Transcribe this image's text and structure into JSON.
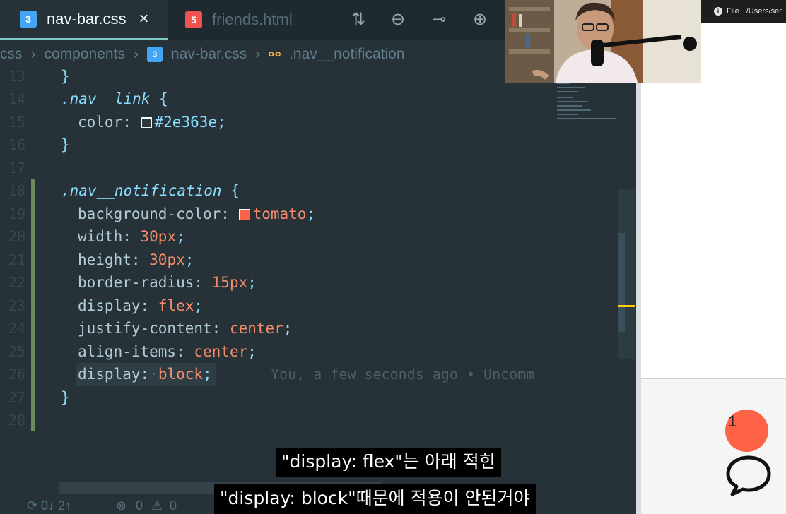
{
  "editor": {
    "tabs": [
      {
        "label": "nav-bar.css",
        "icon": "css3-icon",
        "active": true
      },
      {
        "label": "friends.html",
        "icon": "html5-icon",
        "active": false
      }
    ],
    "toolbar_icons": [
      "source-control-icon",
      "go-back-icon",
      "timeline-icon",
      "go-forward-icon"
    ],
    "breadcrumb": [
      "css",
      "components",
      "nav-bar.css",
      ".nav__notification"
    ],
    "lines": [
      {
        "n": "13",
        "text": "}"
      },
      {
        "n": "14",
        "text": ".nav__link {"
      },
      {
        "n": "15",
        "text": "color: #2e363e;"
      },
      {
        "n": "16",
        "text": "}"
      },
      {
        "n": "17",
        "text": ""
      },
      {
        "n": "18",
        "text": ".nav__notification {"
      },
      {
        "n": "19",
        "text": "background-color: tomato;"
      },
      {
        "n": "20",
        "text": "width: 30px;"
      },
      {
        "n": "21",
        "text": "height: 30px;"
      },
      {
        "n": "22",
        "text": "border-radius: 15px;"
      },
      {
        "n": "23",
        "text": "display: flex;"
      },
      {
        "n": "24",
        "text": "justify-content: center;"
      },
      {
        "n": "25",
        "text": "align-items: center;"
      },
      {
        "n": "26",
        "text": "display: block;"
      },
      {
        "n": "27",
        "text": "}"
      },
      {
        "n": "28",
        "text": ""
      }
    ],
    "code": {
      "l13": "}",
      "l14_sel": ".nav__link",
      "l14_brace": " {",
      "l15_prop": "color: ",
      "l15_val": "#2e363e",
      "l15_end": ";",
      "l16": "}",
      "l18_sel": ".nav__notification",
      "l18_brace": " {",
      "l19_prop": "background-color: ",
      "l19_val": "tomato",
      "l19_end": ";",
      "l20_prop": "width: ",
      "l20_val": "30px",
      "l20_end": ";",
      "l21_prop": "height: ",
      "l21_val": "30px",
      "l21_end": ";",
      "l22_prop": "border-radius: ",
      "l22_val": "15px",
      "l22_end": ";",
      "l23_prop": "display: ",
      "l23_val": "flex",
      "l23_end": ";",
      "l24_prop": "justify-content: ",
      "l24_val": "center",
      "l24_end": ";",
      "l25_prop": "align-items: ",
      "l25_val": "center",
      "l25_end": ";",
      "l26_prop": "display:",
      "l26_dot": "·",
      "l26_val": "block",
      "l26_end": ";",
      "l27": "}"
    },
    "blame": "You, a few seconds ago • Uncomm",
    "status": {
      "sync": "0↓ 2↑",
      "errors": "0",
      "warnings": "0"
    },
    "colors": {
      "background": "#263238",
      "accent": "#80cbc4",
      "selector": "#89ddff",
      "value": "#f78c6c"
    }
  },
  "browser": {
    "file_label": "File",
    "path": "/Users/ser",
    "notification_count": "1",
    "badge_color": "tomato"
  },
  "subtitles": {
    "line1": "\"display: flex\"는 아래 적힌",
    "line2": "\"display: block\"때문에 적용이 안된거야"
  }
}
